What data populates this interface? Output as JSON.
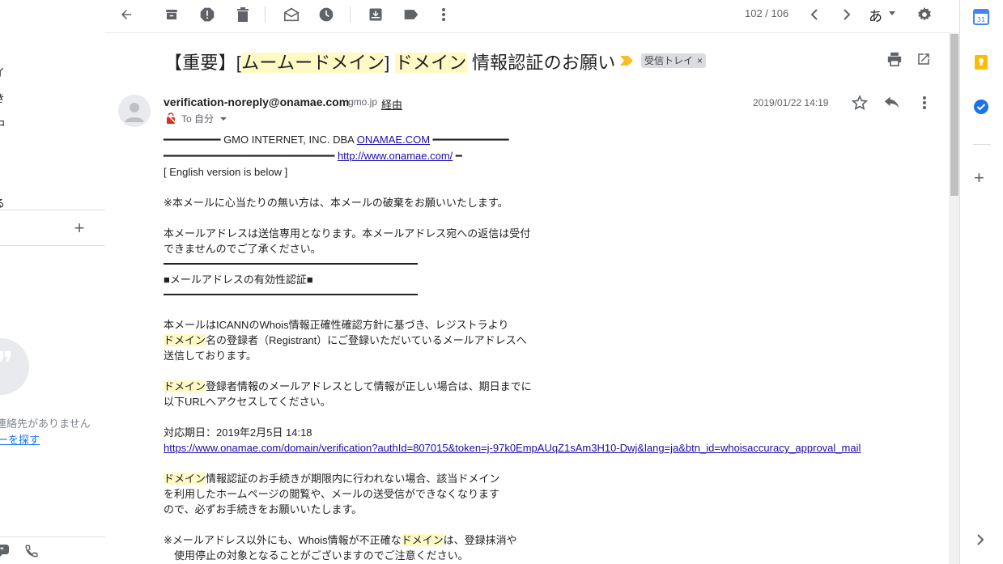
{
  "left_sidebar": {
    "partial_labels": [
      "イ",
      "き",
      "中",
      "る"
    ],
    "no_contacts_text": "連絡先がありません",
    "find_contacts_link": "ーを探す"
  },
  "toolbar": {
    "pager": "102 / 106",
    "ime_indicator": "あ"
  },
  "subject": {
    "prefix": "【重要】[",
    "hl1": "ムームードメイン",
    "middle": "] ",
    "hl2": "ドメイン",
    "suffix": " 情報認証のお願い",
    "label": "受信トレイ",
    "label_close": "×"
  },
  "message": {
    "sender_email": "verification-noreply@onamae.com",
    "sender_domain": "gmo.jp",
    "via": "経由",
    "to_line": "To 自分",
    "date": "2019/01/22 14:19"
  },
  "body": {
    "l1_dashes_left": "━━━━━━━━━",
    "l1_text": " GMO INTERNET, INC. DBA ",
    "l1_link": "ONAMAE.COM",
    "l1_dashes_right": " ━━━━━━━━━━━━",
    "l2_dashes": "━━━━━━━━━━━━━━━━━━━━━━━━━━━ ",
    "l2_link": "http://www.onamae.com/",
    "l2_tail": " ━",
    "english": "[ English version is below ]",
    "notice": "※本メールに心当たりの無い方は、本メールの破棄をお願いいたします。",
    "sendonly_1": "本メールアドレスは送信専用となります。本メールアドレス宛への返信は受付",
    "sendonly_2": "できませんのでご了承ください。",
    "section_title": "■メールアドレスの有効性認証■",
    "p1_1": "本メールはICANNのWhois情報正確性確認方針に基づき、レジストラより",
    "p1_2_hl": "ドメイン",
    "p1_2": "名の登録者（Registrant）にご登録いただいているメールアドレスへ",
    "p1_3": "送信しております。",
    "p2_1_hl": "ドメイン",
    "p2_1": "登録者情報のメールアドレスとして情報が正しい場合は、期日までに",
    "p2_2": "以下URLへアクセスしてください。",
    "deadline": "対応期日：2019年2月5日 14:18",
    "verify_link": "https://www.onamae.com/domain/verification?authId=807015&token=j-97k0EmpAUqZ1sAm3H10-Dwj&lang=ja&btn_id=whoisaccuracy_approval_mail",
    "p3_1_hl": "ドメイン",
    "p3_1": "情報認証のお手続きが期限内に行われない場合、該当ドメイン",
    "p3_2": "を利用したホームページの閲覧や、メールの送受信ができなくなります",
    "p3_3": "ので、必ずお手続きをお願いいたします。",
    "p4_1a": "※メールアドレス以外にも、Whois情報が不正確な",
    "p4_1_hl": "ドメイン",
    "p4_1b": "は、登録抹消や",
    "p4_2": "　使用停止の対象となることがございますのでご注意ください。"
  },
  "side_panel": {
    "calendar_day": "31"
  },
  "colors": {
    "highlight": "#fff9c4",
    "link": "#1a0dab",
    "calendar_blue": "#4285f4",
    "keep_yellow": "#fbbc04",
    "tasks_blue": "#1a73e8",
    "importance": "#f6bf26"
  }
}
